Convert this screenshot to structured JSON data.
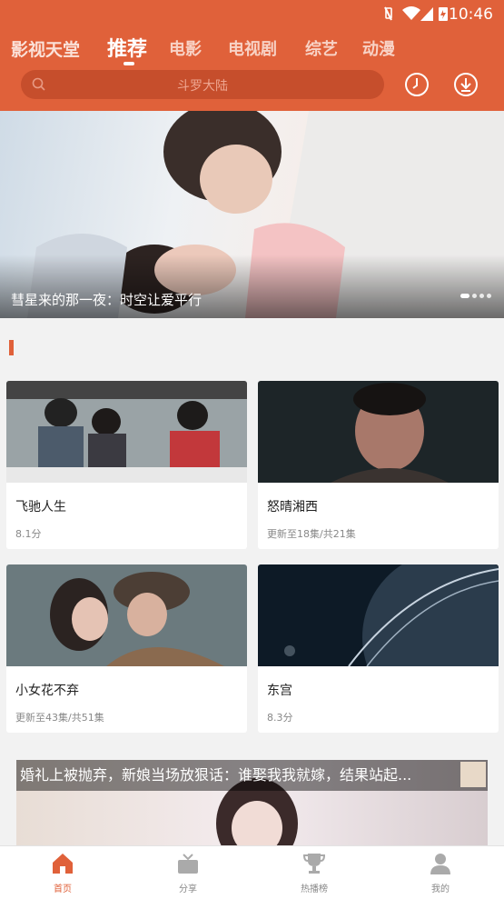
{
  "status_bar": {
    "time": "10:46"
  },
  "header": {
    "brand": "影视天堂",
    "tabs": [
      {
        "label": "推荐",
        "active": true
      },
      {
        "label": "电影"
      },
      {
        "label": "电视剧"
      },
      {
        "label": "综艺"
      },
      {
        "label": "动漫"
      }
    ],
    "search": {
      "placeholder": "斗罗大陆"
    },
    "icons": {
      "history": "clock-icon",
      "download": "download-icon"
    }
  },
  "banner": {
    "caption": "彗星来的那一夜：时空让爱平行",
    "slide_count": 4,
    "active_slide": 1
  },
  "cards": [
    {
      "title": "飞驰人生",
      "sub": "8.1分"
    },
    {
      "title": "怒晴湘西",
      "sub": "更新至18集/共21集"
    },
    {
      "title": "小女花不弃",
      "sub": "更新至43集/共51集"
    },
    {
      "title": "东宫",
      "sub": "8.3分"
    }
  ],
  "promo": {
    "title": "婚礼上被抛弃，新娘当场放狠话：谁娶我我就嫁，结果站起..."
  },
  "bottom_nav": [
    {
      "label": "首页",
      "icon": "home-icon",
      "active": true
    },
    {
      "label": "分享",
      "icon": "share-box-icon"
    },
    {
      "label": "热播榜",
      "icon": "trophy-icon"
    },
    {
      "label": "我的",
      "icon": "user-icon"
    }
  ],
  "colors": {
    "accent": "#e0613a",
    "search_bg": "#c64e2c"
  }
}
